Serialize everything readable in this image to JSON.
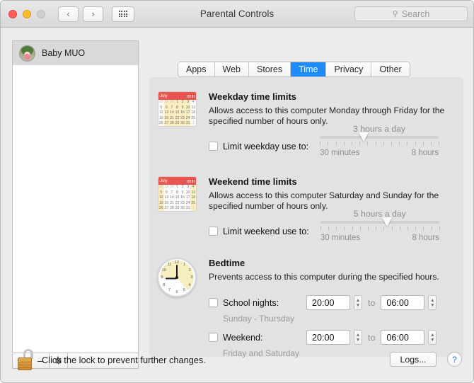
{
  "window": {
    "title": "Parental Controls",
    "traffic_lights": [
      "close",
      "minimize",
      "zoom"
    ],
    "nav": {
      "back": "‹",
      "forward": "›",
      "show_all": "show-all-grid"
    }
  },
  "search": {
    "placeholder": "Search",
    "icon": "search-icon"
  },
  "sidebar": {
    "users": [
      {
        "name": "Baby MUO",
        "selected": true
      }
    ],
    "toolbar": {
      "add": "+",
      "remove": "−",
      "action": "⚙"
    }
  },
  "tabs": [
    {
      "label": "Apps",
      "active": false
    },
    {
      "label": "Web",
      "active": false
    },
    {
      "label": "Stores",
      "active": false
    },
    {
      "label": "Time",
      "active": true
    },
    {
      "label": "Privacy",
      "active": false
    },
    {
      "label": "Other",
      "active": false
    }
  ],
  "sections": {
    "weekday": {
      "icon": "calendar-weekday-icon",
      "calendar_month": "July",
      "title": "Weekday time limits",
      "description": "Allows access to this computer Monday through Friday for the specified number of hours only.",
      "checkbox_label": "Limit weekday use to:",
      "checked": false,
      "slider": {
        "value_text": "3 hours a day",
        "min_label": "30 minutes",
        "max_label": "8 hours",
        "position_percent": 37,
        "tick_count": 16
      }
    },
    "weekend": {
      "icon": "calendar-weekend-icon",
      "calendar_month": "July",
      "title": "Weekend time limits",
      "description": "Allows access to this computer Saturday and Sunday for the specified number of hours only.",
      "checkbox_label": "Limit weekend use to:",
      "checked": false,
      "slider": {
        "value_text": "5 hours a day",
        "min_label": "30 minutes",
        "max_label": "8 hours",
        "position_percent": 56,
        "tick_count": 16
      }
    },
    "bedtime": {
      "icon": "clock-icon",
      "title": "Bedtime",
      "description": "Prevents access to this computer during the specified hours.",
      "rows": [
        {
          "checkbox_label": "School nights:",
          "sub_label": "Sunday - Thursday",
          "checked": false,
          "from": "20:00",
          "to_label": "to",
          "to": "06:00"
        },
        {
          "checkbox_label": "Weekend:",
          "sub_label": "Friday and Saturday",
          "checked": false,
          "from": "20:00",
          "to_label": "to",
          "to": "06:00"
        }
      ]
    }
  },
  "footer": {
    "lock_icon": "unlocked-padlock-icon",
    "lock_text": "Click the lock to prevent further changes.",
    "logs_button": "Logs...",
    "help_button": "?"
  },
  "colors": {
    "accent": "#1e8bfa",
    "calendar_header": "#e8544f",
    "calendar_highlight": "#fbeec2",
    "lock_body": "#d99a3f",
    "pane_bg": "#e2e2e2",
    "window_bg": "#ececec"
  },
  "calendar_rows": [
    [
      {
        "d": "28",
        "dim": true
      },
      {
        "d": "29",
        "dim": true
      },
      {
        "d": "30",
        "dim": true
      },
      {
        "d": "1"
      },
      {
        "d": "2"
      },
      {
        "d": "3"
      },
      {
        "d": "4"
      }
    ],
    [
      {
        "d": "5"
      },
      {
        "d": "6"
      },
      {
        "d": "7"
      },
      {
        "d": "8"
      },
      {
        "d": "9"
      },
      {
        "d": "10"
      },
      {
        "d": "11"
      }
    ],
    [
      {
        "d": "12"
      },
      {
        "d": "13"
      },
      {
        "d": "14"
      },
      {
        "d": "15"
      },
      {
        "d": "16"
      },
      {
        "d": "17"
      },
      {
        "d": "18"
      }
    ],
    [
      {
        "d": "19"
      },
      {
        "d": "20"
      },
      {
        "d": "21"
      },
      {
        "d": "22"
      },
      {
        "d": "23"
      },
      {
        "d": "24"
      },
      {
        "d": "25"
      }
    ],
    [
      {
        "d": "26"
      },
      {
        "d": "27"
      },
      {
        "d": "28"
      },
      {
        "d": "29"
      },
      {
        "d": "30"
      },
      {
        "d": "31"
      },
      {
        "d": "1",
        "dim": true
      }
    ]
  ],
  "clock": {
    "hour": 9,
    "minute": 0,
    "numerals": [
      "12",
      "1",
      "2",
      "3",
      "4",
      "5",
      "6",
      "7",
      "8",
      "9",
      "10",
      "11"
    ]
  }
}
